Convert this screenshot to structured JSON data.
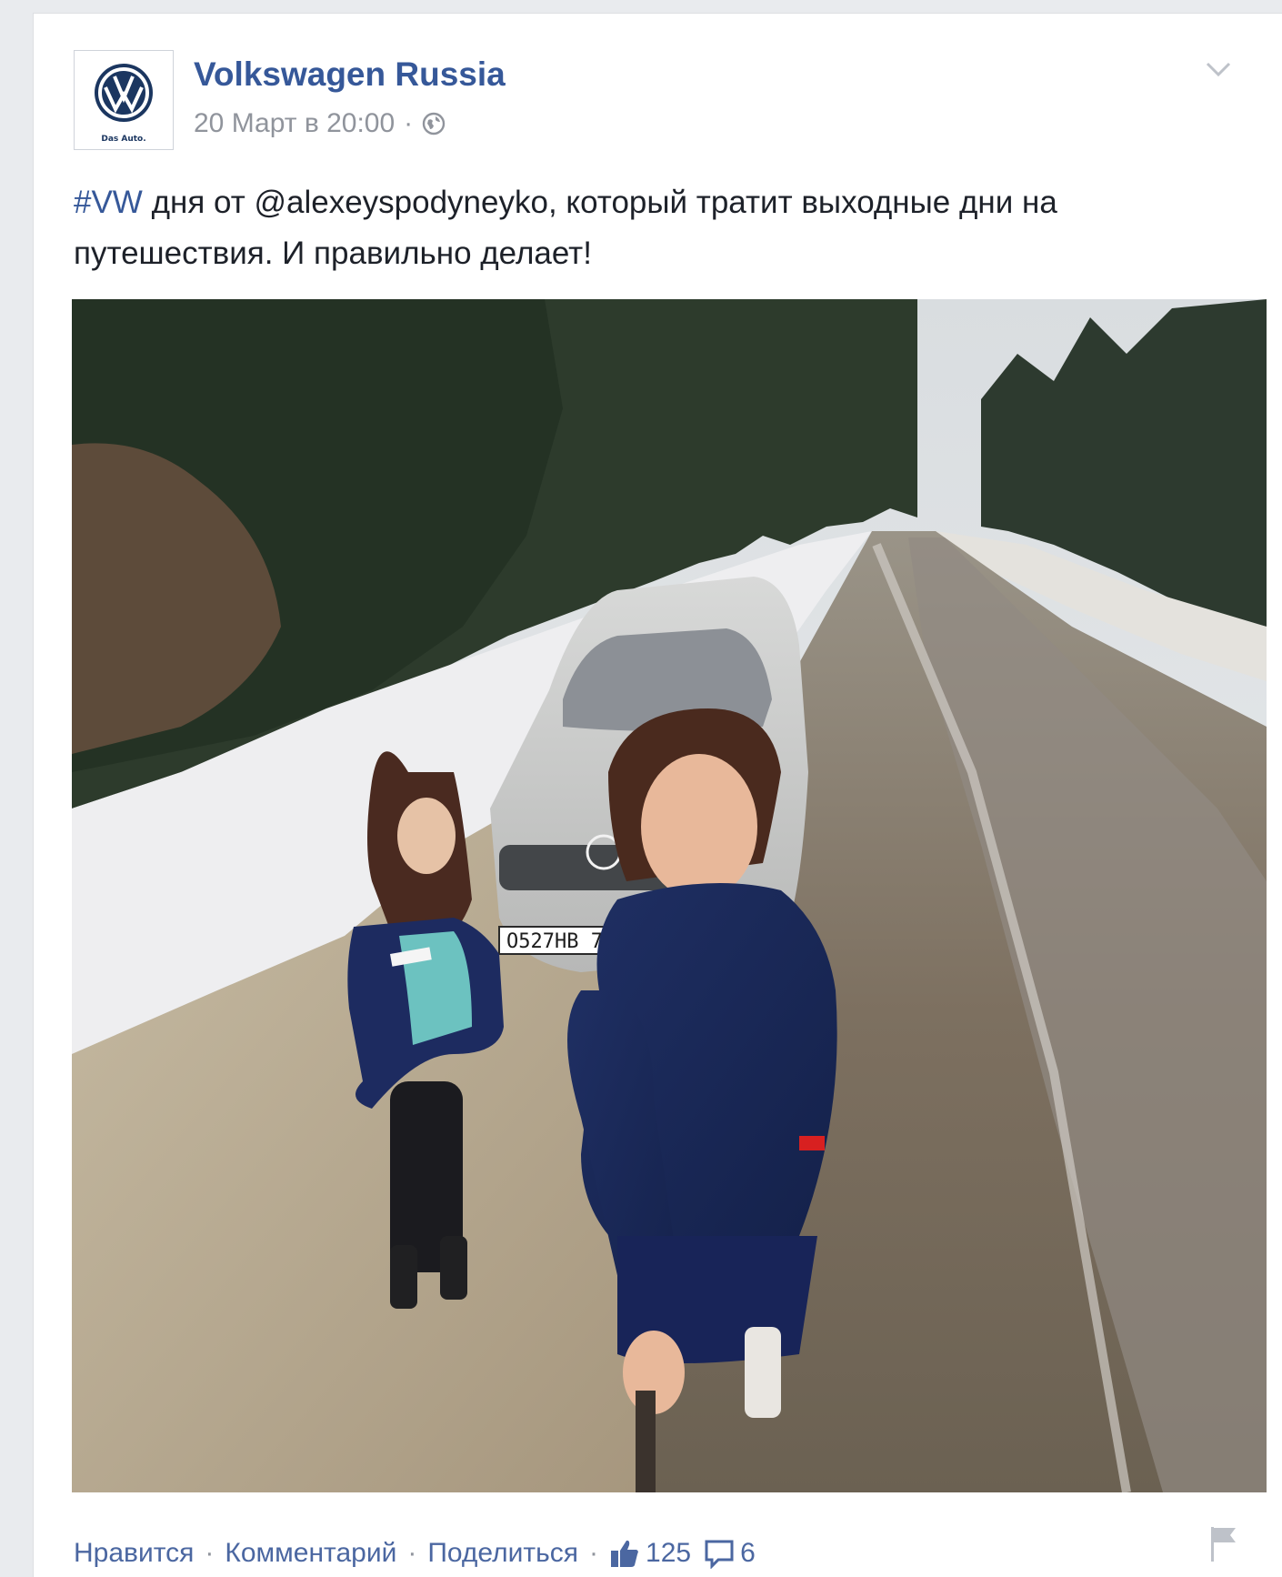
{
  "post": {
    "page_name": "Volkswagen Russia",
    "avatar_slogan": "Das Auto.",
    "timestamp": "20 Март в 20:00",
    "meta_separator": "·",
    "privacy_icon": "globe-icon",
    "text": {
      "hashtag": "#VW",
      "body": " дня от @alexeyspodyneyko, который тратит выходные дни на путешествия. И правильно делает!"
    },
    "photo": {
      "license_plate": "О527НВ 77"
    },
    "actions": {
      "like": "Нравится",
      "comment": "Комментарий",
      "share": "Поделиться",
      "separator": "·",
      "like_count": "125",
      "comment_count": "6"
    }
  },
  "colors": {
    "link_blue": "#365899",
    "action_blue": "#4b67a1",
    "meta_gray": "#90949c",
    "text": "#1d2129",
    "page_background": "#e9ebee"
  }
}
